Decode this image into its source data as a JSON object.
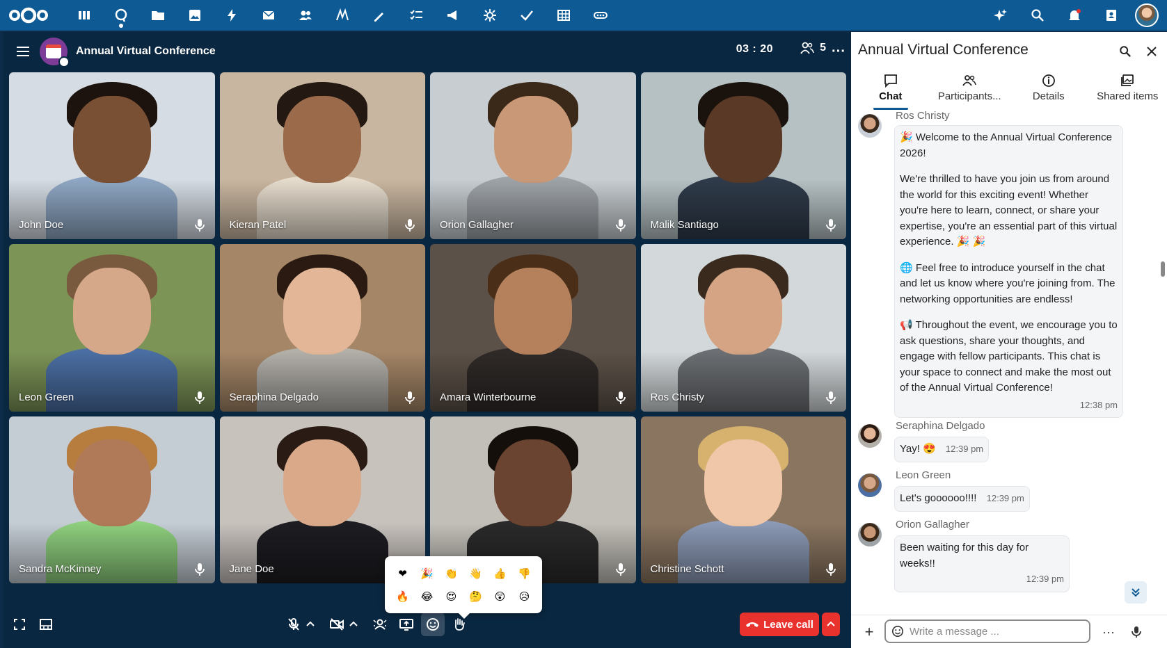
{
  "topbar": {
    "apps": [
      "dashboard-icon",
      "talk-icon",
      "files-icon",
      "photos-icon",
      "activity-icon",
      "mail-icon",
      "contacts-icon",
      "notes-icon",
      "text-icon",
      "tasks-icon",
      "announcements-icon",
      "settings-icon",
      "checkmark-icon",
      "spreadsheet-icon",
      "more-apps-icon"
    ],
    "right": [
      "assistant-icon",
      "search-icon",
      "notifications-icon",
      "contacts-menu-icon"
    ]
  },
  "call": {
    "title": "Annual Virtual Conference",
    "timer": "03 : 20",
    "participants_count": "5",
    "tiles": [
      {
        "name": "John Doe",
        "bg": "#d5dce4",
        "skin": "#7a5034",
        "hair": "#1c130e",
        "shirt": "#8fa7c4"
      },
      {
        "name": "Kieran Patel",
        "bg": "#c9b6a0",
        "skin": "#9b6a4b",
        "hair": "#231812",
        "shirt": "#e6dccd"
      },
      {
        "name": "Orion Gallagher",
        "bg": "#c7cdd1",
        "skin": "#c99877",
        "hair": "#3a2818",
        "shirt": "#9ea3a8"
      },
      {
        "name": "Malik Santiago",
        "bg": "#b6c1c4",
        "skin": "#5a3a26",
        "hair": "#1a120c",
        "shirt": "#2f3b4a"
      },
      {
        "name": "Leon Green",
        "bg": "#7d9457",
        "skin": "#d6a88a",
        "hair": "#7a5a3e",
        "shirt": "#4b6fa4"
      },
      {
        "name": "Seraphina Delgado",
        "bg": "#a58667",
        "skin": "#e2b697",
        "hair": "#2a1a12",
        "shirt": "#b3b0aa"
      },
      {
        "name": "Amara Winterbourne",
        "bg": "#5c5148",
        "skin": "#b5815c",
        "hair": "#4a2e18",
        "shirt": "#2f2a28"
      },
      {
        "name": "Ros Christy",
        "bg": "#d3d8da",
        "skin": "#d4a484",
        "hair": "#3a2a1e",
        "shirt": "#6c6f73"
      },
      {
        "name": "Sandra McKinney",
        "bg": "#c4ccd4",
        "skin": "#b07a58",
        "hair": "#b77d3e",
        "shirt": "#8fcf7e"
      },
      {
        "name": "Jane Doe",
        "bg": "#c8c2bd",
        "skin": "#d9a98a",
        "hair": "#2a1c14",
        "shirt": "#1d1d22"
      },
      {
        "name": "",
        "bg": "#c2bfb8",
        "skin": "#6a4430",
        "hair": "#150f0b",
        "shirt": "#2a2a2a"
      },
      {
        "name": "Christine Schott",
        "bg": "#8a7560",
        "skin": "#f0c7a8",
        "hair": "#d7b26e",
        "shirt": "#8c9ab6"
      }
    ],
    "emojis": [
      "❤",
      "🎉",
      "👏",
      "👋",
      "👍",
      "👎",
      "🔥",
      "😂",
      "😍",
      "🤔",
      "😲",
      "😥"
    ],
    "leave_label": "Leave call"
  },
  "panel": {
    "title": "Annual Virtual Conference",
    "tabs": [
      {
        "label": "Chat",
        "icon": "chat-icon"
      },
      {
        "label": "Participants...",
        "icon": "participants-icon"
      },
      {
        "label": "Details",
        "icon": "info-icon"
      },
      {
        "label": "Shared items",
        "icon": "shared-items-icon"
      }
    ],
    "messages": [
      {
        "sender": "Ros Christy",
        "paragraphs": [
          "🎉 Welcome to the Annual Virtual Conference 2026!",
          "We're thrilled to have you join us from around the world for this exciting event! Whether you're here to learn, connect, or share your expertise, you're an essential part of this virtual experience. 🎉 🎉",
          "🌐 Feel free to introduce yourself in the chat and let us know where you're joining from. The networking opportunities are endless!",
          "📢 Throughout the event, we encourage you to ask questions, share your thoughts, and engage with fellow participants. This chat is your space to connect and make the most out of the Annual Virtual Conference!"
        ],
        "time": "12:38 pm"
      },
      {
        "sender": "Seraphina Delgado",
        "text": "Yay! 😍",
        "time": "12:39 pm"
      },
      {
        "sender": "Leon Green",
        "text": "Let's goooooo!!!!",
        "time": "12:39 pm"
      },
      {
        "sender": "Orion Gallagher",
        "text": "Been waiting for this day for weeks!!",
        "time": "12:39 pm"
      }
    ],
    "composer_placeholder": "Write a message ..."
  },
  "colors": {
    "topbar": "#0e5a95",
    "leave": "#e9322d",
    "call_bg": "#0a2741"
  }
}
